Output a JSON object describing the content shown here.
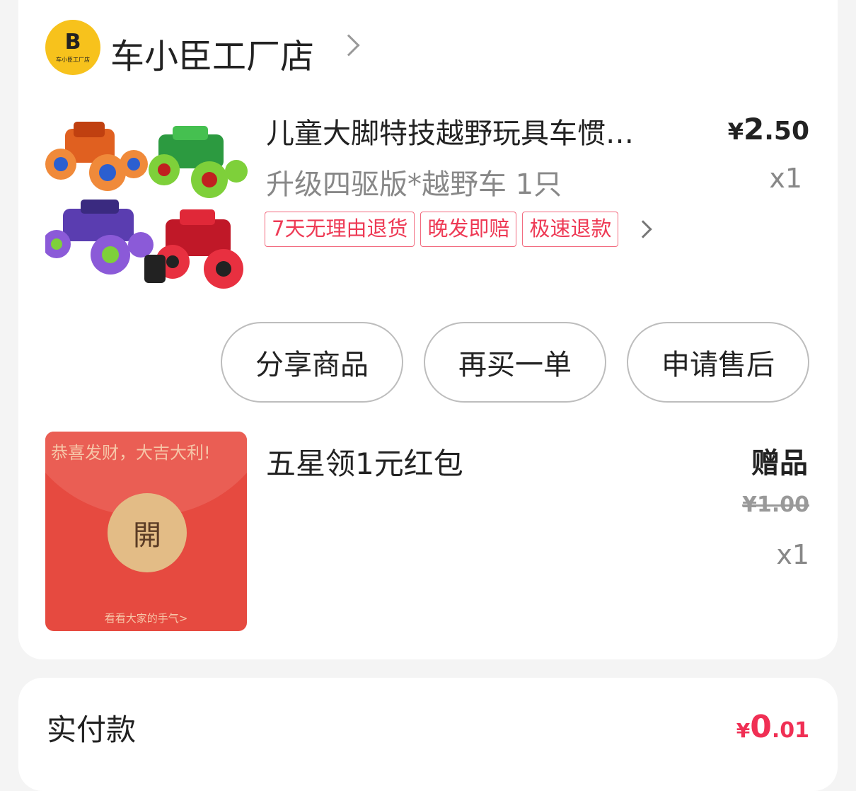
{
  "shop": {
    "name": "车小臣工厂店",
    "logo_text": "车小臣工厂店"
  },
  "product": {
    "title": "儿童大脚特技越野玩具车惯…",
    "price_symbol": "¥",
    "price_int": "2",
    "price_dec": ".50",
    "spec": "升级四驱版*越野车 1只",
    "qty": "x1",
    "tags": [
      "7天无理由退货",
      "晚发即赔",
      "极速退款"
    ]
  },
  "actions": {
    "share": "分享商品",
    "rebuy": "再买一单",
    "after_sale": "申请售后"
  },
  "gift": {
    "title": "五星领1元红包",
    "badge": "赠品",
    "orig_price": "¥1.00",
    "qty": "x1",
    "image": {
      "greeting": "恭喜发财，大吉大利!",
      "open": "開",
      "note": "看看大家的手气>"
    }
  },
  "payment": {
    "label": "实付款",
    "symbol": "¥",
    "int": "0",
    "dec": ".01"
  },
  "colors": {
    "price_red": "#f02f54",
    "tag_red": "#ee3a55",
    "logo_yellow": "#f7c21c",
    "envelope_red": "#e64a40"
  }
}
